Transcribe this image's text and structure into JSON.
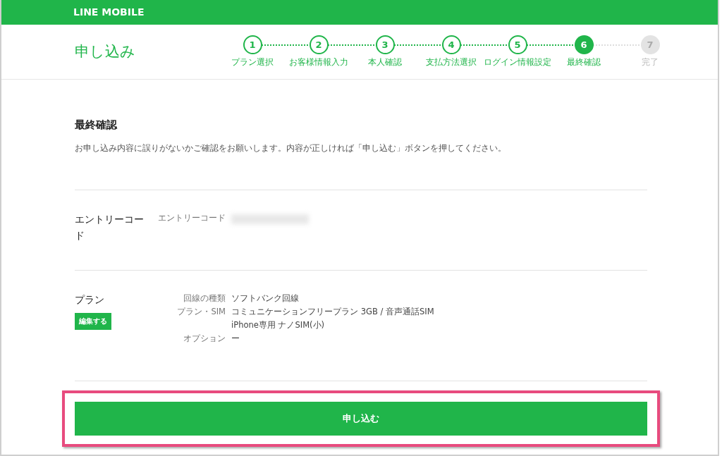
{
  "header": {
    "logo": "LINE MOBILE"
  },
  "page_title": "申し込み",
  "steps": [
    {
      "number": "1",
      "label": "プラン選択",
      "completed": true,
      "selected": false
    },
    {
      "number": "2",
      "label": "お客様情報入力",
      "completed": true,
      "selected": false
    },
    {
      "number": "3",
      "label": "本人確認",
      "completed": true,
      "selected": false
    },
    {
      "number": "4",
      "label": "支払方法選択",
      "completed": true,
      "selected": false
    },
    {
      "number": "5",
      "label": "ログイン情報設定",
      "completed": true,
      "selected": false
    },
    {
      "number": "6",
      "label": "最終確認",
      "completed": false,
      "selected": true
    },
    {
      "number": "7",
      "label": "完了",
      "completed": false,
      "selected": false
    }
  ],
  "intro": {
    "heading": "最終確認",
    "text": "お申し込み内容に誤りがないかご確認をお願いします。内容が正しければ「申し込む」ボタンを押してください。"
  },
  "sections": [
    {
      "title": "エントリーコード",
      "rows": [
        {
          "label": "エントリーコード",
          "kind": "masked"
        }
      ]
    },
    {
      "title": "プラン",
      "edit_button": "編集する",
      "rows": [
        {
          "label": "回線の種類",
          "kind": "text",
          "lines": [
            "ソフトバンク回線"
          ]
        },
        {
          "label": "プラン・SIM",
          "kind": "text",
          "lines": [
            "コミュニケーションフリープラン 3GB / 音声通話SIM",
            "iPhone専用 ナノSIM(小)"
          ]
        },
        {
          "label": "オプション",
          "kind": "text",
          "lines": [
            "ー"
          ]
        }
      ]
    }
  ],
  "submit": {
    "label": "申し込む",
    "highlighted": true
  }
}
